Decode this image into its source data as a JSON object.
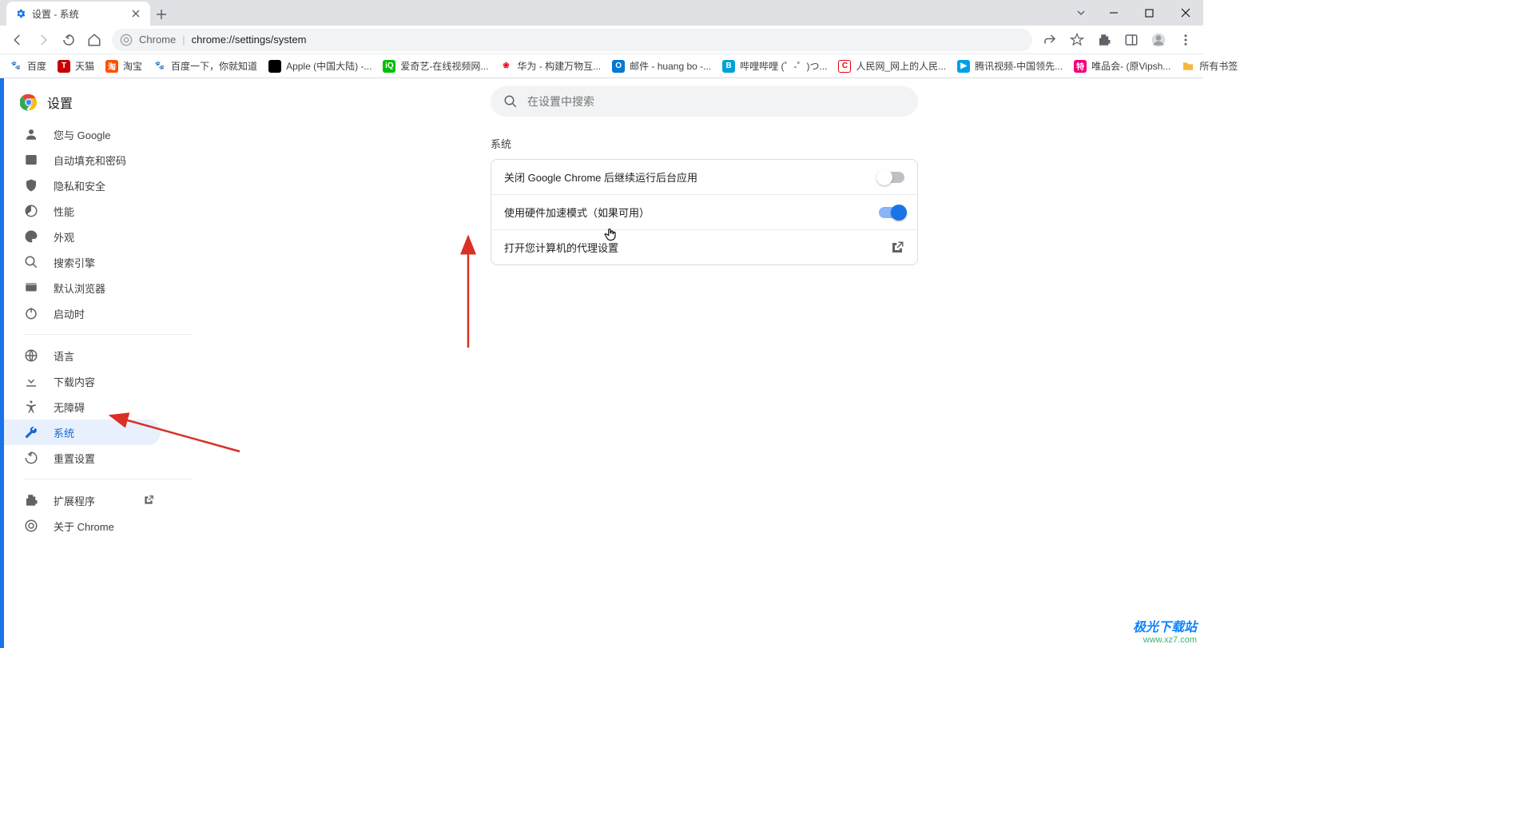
{
  "window": {
    "title": "设置 - 系统"
  },
  "addressbar": {
    "chrome_label": "Chrome",
    "url": "chrome://settings/system"
  },
  "bookmarks": {
    "items": [
      {
        "label": "百度",
        "fav": "🐾",
        "bg": "#2932e1"
      },
      {
        "label": "天猫",
        "fav": "T",
        "bg": "#c40000"
      },
      {
        "label": "淘宝",
        "fav": "淘",
        "bg": "#ff5000"
      },
      {
        "label": "百度一下，你就知道",
        "fav": "🐾",
        "bg": "#2932e1"
      },
      {
        "label": "Apple (中国大陆) -...",
        "fav": "",
        "bg": "#000"
      },
      {
        "label": "爱奇艺-在线视频网...",
        "fav": "iQ",
        "bg": "#00be06"
      },
      {
        "label": "华为 - 构建万物互...",
        "fav": "❀",
        "bg": "#e60012"
      },
      {
        "label": "邮件 - huang bo -...",
        "fav": "O",
        "bg": "#0078d4"
      },
      {
        "label": "哔哩哔哩 (゜-゜)つ...",
        "fav": "B",
        "bg": "#00a1d6"
      },
      {
        "label": "人民网_网上的人民...",
        "fav": "C",
        "bg": "#e60012"
      },
      {
        "label": "腾讯视频-中国领先...",
        "fav": "▶",
        "bg": "#00a0e9"
      },
      {
        "label": "唯品会- (原Vipsh...",
        "fav": "特",
        "bg": "#f10180"
      }
    ],
    "all_bookmarks": "所有书签"
  },
  "settings_title": "设置",
  "sidebar": {
    "items": [
      {
        "label": "您与 Google"
      },
      {
        "label": "自动填充和密码"
      },
      {
        "label": "隐私和安全"
      },
      {
        "label": "性能"
      },
      {
        "label": "外观"
      },
      {
        "label": "搜索引擎"
      },
      {
        "label": "默认浏览器"
      },
      {
        "label": "启动时"
      }
    ],
    "items2": [
      {
        "label": "语言"
      },
      {
        "label": "下载内容"
      },
      {
        "label": "无障碍"
      },
      {
        "label": "系统"
      },
      {
        "label": "重置设置"
      }
    ],
    "items3": [
      {
        "label": "扩展程序"
      },
      {
        "label": "关于 Chrome"
      }
    ]
  },
  "search": {
    "placeholder": "在设置中搜索"
  },
  "section_title": "系统",
  "rows": {
    "bg_apps": "关闭 Google Chrome 后继续运行后台应用",
    "hw_accel": "使用硬件加速模式（如果可用）",
    "proxy": "打开您计算机的代理设置"
  },
  "watermark": {
    "line1": "极光下载站",
    "line2": "www.xz7.com"
  }
}
